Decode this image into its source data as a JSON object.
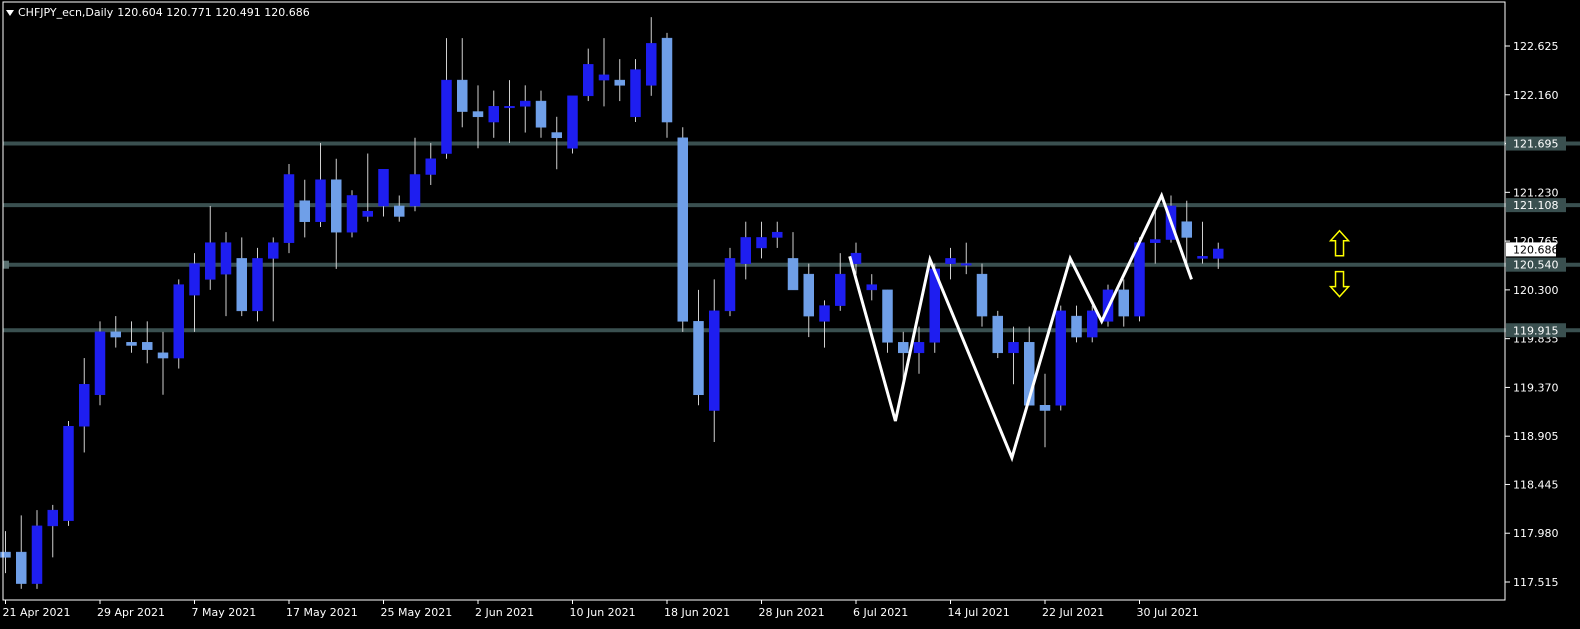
{
  "header": {
    "symbol_label": "CHFJPY_ecn,Daily",
    "ohlc": "120.604 120.771 120.491 120.686"
  },
  "colors": {
    "background": "#000000",
    "frame": "#ffffff",
    "bull_candle": "#1e1ef0",
    "bear_candle": "#6f9fe8",
    "wick": "#d0d0d0",
    "level_line": "#3a5050",
    "pattern_line": "#ffffff",
    "arrow": "#ffff00",
    "price_tag_bg": "#ffffff"
  },
  "icons": {
    "up_arrow": "up-arrow-icon",
    "down_arrow": "down-arrow-icon"
  },
  "chart_data": {
    "type": "candlestick",
    "title": "CHFJPY_ecn,Daily",
    "ylim": [
      117.3,
      122.9
    ],
    "grid": false,
    "y_ticks": [
      "122.625",
      "122.160",
      "121.695",
      "121.230",
      "120.765",
      "120.300",
      "119.835",
      "119.370",
      "118.905",
      "118.445",
      "117.980",
      "117.515"
    ],
    "x_ticks": [
      "21 Apr 2021",
      "29 Apr 2021",
      "7 May 2021",
      "17 May 2021",
      "25 May 2021",
      "2 Jun 2021",
      "10 Jun 2021",
      "18 Jun 2021",
      "28 Jun 2021",
      "6 Jul 2021",
      "14 Jul 2021",
      "22 Jul 2021",
      "30 Jul 2021"
    ],
    "current_price": "120.686",
    "levels": [
      {
        "price": 121.695,
        "label": "121.695"
      },
      {
        "price": 121.108,
        "label": "121.108"
      },
      {
        "price": 120.54,
        "label": "120.540"
      },
      {
        "price": 119.915,
        "label": "119.915"
      }
    ],
    "candles": [
      {
        "o": 117.8,
        "h": 118.0,
        "l": 117.6,
        "c": 117.75
      },
      {
        "o": 117.8,
        "h": 118.15,
        "l": 117.45,
        "c": 117.5
      },
      {
        "o": 117.5,
        "h": 118.2,
        "l": 117.45,
        "c": 118.05
      },
      {
        "o": 118.05,
        "h": 118.25,
        "l": 117.75,
        "c": 118.2
      },
      {
        "o": 118.1,
        "h": 119.05,
        "l": 118.05,
        "c": 119.0
      },
      {
        "o": 119.0,
        "h": 119.65,
        "l": 118.75,
        "c": 119.4
      },
      {
        "o": 119.3,
        "h": 120.0,
        "l": 119.2,
        "c": 119.9
      },
      {
        "o": 119.9,
        "h": 120.05,
        "l": 119.75,
        "c": 119.85
      },
      {
        "o": 119.8,
        "h": 120.0,
        "l": 119.7,
        "c": 119.77
      },
      {
        "o": 119.8,
        "h": 120.0,
        "l": 119.6,
        "c": 119.73
      },
      {
        "o": 119.7,
        "h": 119.9,
        "l": 119.3,
        "c": 119.65
      },
      {
        "o": 119.65,
        "h": 120.4,
        "l": 119.55,
        "c": 120.35
      },
      {
        "o": 120.25,
        "h": 120.65,
        "l": 119.9,
        "c": 120.55
      },
      {
        "o": 120.4,
        "h": 121.1,
        "l": 120.3,
        "c": 120.75
      },
      {
        "o": 120.45,
        "h": 120.85,
        "l": 120.05,
        "c": 120.75
      },
      {
        "o": 120.6,
        "h": 120.8,
        "l": 120.05,
        "c": 120.1
      },
      {
        "o": 120.1,
        "h": 120.7,
        "l": 120.0,
        "c": 120.6
      },
      {
        "o": 120.6,
        "h": 120.8,
        "l": 120.0,
        "c": 120.75
      },
      {
        "o": 120.75,
        "h": 121.5,
        "l": 120.65,
        "c": 121.4
      },
      {
        "o": 121.15,
        "h": 121.35,
        "l": 120.8,
        "c": 120.95
      },
      {
        "o": 120.95,
        "h": 121.7,
        "l": 120.9,
        "c": 121.35
      },
      {
        "o": 121.35,
        "h": 121.55,
        "l": 120.5,
        "c": 120.85
      },
      {
        "o": 120.85,
        "h": 121.25,
        "l": 120.8,
        "c": 121.2
      },
      {
        "o": 121.0,
        "h": 121.6,
        "l": 120.95,
        "c": 121.05
      },
      {
        "o": 121.1,
        "h": 121.4,
        "l": 121.0,
        "c": 121.45
      },
      {
        "o": 121.1,
        "h": 121.2,
        "l": 120.95,
        "c": 121.0
      },
      {
        "o": 121.1,
        "h": 121.75,
        "l": 121.05,
        "c": 121.4
      },
      {
        "o": 121.4,
        "h": 121.7,
        "l": 121.3,
        "c": 121.55
      },
      {
        "o": 121.6,
        "h": 122.7,
        "l": 121.55,
        "c": 122.3
      },
      {
        "o": 122.3,
        "h": 122.7,
        "l": 121.85,
        "c": 122.0
      },
      {
        "o": 122.0,
        "h": 122.25,
        "l": 121.65,
        "c": 121.95
      },
      {
        "o": 121.9,
        "h": 122.2,
        "l": 121.75,
        "c": 122.05
      },
      {
        "o": 122.05,
        "h": 122.3,
        "l": 121.7,
        "c": 122.05
      },
      {
        "o": 122.05,
        "h": 122.25,
        "l": 121.8,
        "c": 122.1
      },
      {
        "o": 122.1,
        "h": 122.2,
        "l": 121.75,
        "c": 121.85
      },
      {
        "o": 121.8,
        "h": 121.95,
        "l": 121.45,
        "c": 121.75
      },
      {
        "o": 121.65,
        "h": 122.1,
        "l": 121.6,
        "c": 122.15
      },
      {
        "o": 122.15,
        "h": 122.6,
        "l": 122.1,
        "c": 122.45
      },
      {
        "o": 122.3,
        "h": 122.7,
        "l": 122.05,
        "c": 122.35
      },
      {
        "o": 122.3,
        "h": 122.5,
        "l": 122.1,
        "c": 122.25
      },
      {
        "o": 121.95,
        "h": 122.5,
        "l": 121.9,
        "c": 122.4
      },
      {
        "o": 122.25,
        "h": 122.9,
        "l": 122.15,
        "c": 122.65
      },
      {
        "o": 122.7,
        "h": 122.75,
        "l": 121.75,
        "c": 121.9
      },
      {
        "o": 121.75,
        "h": 121.85,
        "l": 119.9,
        "c": 120.0
      },
      {
        "o": 120.0,
        "h": 120.3,
        "l": 119.2,
        "c": 119.3
      },
      {
        "o": 119.15,
        "h": 120.4,
        "l": 118.85,
        "c": 120.1
      },
      {
        "o": 120.1,
        "h": 120.7,
        "l": 120.05,
        "c": 120.6
      },
      {
        "o": 120.55,
        "h": 120.95,
        "l": 120.4,
        "c": 120.8
      },
      {
        "o": 120.7,
        "h": 120.95,
        "l": 120.6,
        "c": 120.8
      },
      {
        "o": 120.8,
        "h": 120.95,
        "l": 120.7,
        "c": 120.85
      },
      {
        "o": 120.6,
        "h": 120.85,
        "l": 120.3,
        "c": 120.3
      },
      {
        "o": 120.45,
        "h": 120.55,
        "l": 119.85,
        "c": 120.05
      },
      {
        "o": 120.0,
        "h": 120.2,
        "l": 119.75,
        "c": 120.15
      },
      {
        "o": 120.15,
        "h": 120.65,
        "l": 120.1,
        "c": 120.45
      },
      {
        "o": 120.55,
        "h": 120.75,
        "l": 120.45,
        "c": 120.65
      },
      {
        "o": 120.3,
        "h": 120.45,
        "l": 120.2,
        "c": 120.35
      },
      {
        "o": 120.3,
        "h": 120.3,
        "l": 119.7,
        "c": 119.8
      },
      {
        "o": 119.8,
        "h": 119.9,
        "l": 119.4,
        "c": 119.7
      },
      {
        "o": 119.7,
        "h": 119.95,
        "l": 119.5,
        "c": 119.8
      },
      {
        "o": 119.8,
        "h": 120.55,
        "l": 119.7,
        "c": 120.5
      },
      {
        "o": 120.55,
        "h": 120.7,
        "l": 120.4,
        "c": 120.6
      },
      {
        "o": 120.55,
        "h": 120.75,
        "l": 120.45,
        "c": 120.55
      },
      {
        "o": 120.45,
        "h": 120.55,
        "l": 119.95,
        "c": 120.05
      },
      {
        "o": 120.05,
        "h": 120.1,
        "l": 119.65,
        "c": 119.7
      },
      {
        "o": 119.7,
        "h": 119.95,
        "l": 119.4,
        "c": 119.8
      },
      {
        "o": 119.8,
        "h": 119.95,
        "l": 119.2,
        "c": 119.2
      },
      {
        "o": 119.2,
        "h": 119.5,
        "l": 118.8,
        "c": 119.15
      },
      {
        "o": 119.2,
        "h": 120.15,
        "l": 119.15,
        "c": 120.1
      },
      {
        "o": 120.05,
        "h": 120.15,
        "l": 119.8,
        "c": 119.85
      },
      {
        "o": 119.85,
        "h": 120.15,
        "l": 119.8,
        "c": 120.1
      },
      {
        "o": 120.0,
        "h": 120.35,
        "l": 119.95,
        "c": 120.3
      },
      {
        "o": 120.3,
        "h": 120.4,
        "l": 119.95,
        "c": 120.05
      },
      {
        "o": 120.05,
        "h": 120.8,
        "l": 120.0,
        "c": 120.75
      },
      {
        "o": 120.75,
        "h": 121.05,
        "l": 120.55,
        "c": 120.78
      },
      {
        "o": 120.78,
        "h": 121.2,
        "l": 120.75,
        "c": 121.1
      },
      {
        "o": 120.95,
        "h": 121.15,
        "l": 120.55,
        "c": 120.8
      },
      {
        "o": 120.6,
        "h": 120.95,
        "l": 120.55,
        "c": 120.62
      },
      {
        "o": 120.6,
        "h": 120.75,
        "l": 120.5,
        "c": 120.69
      }
    ],
    "pattern_line": [
      {
        "i": 53.6,
        "p": 120.62
      },
      {
        "i": 56.5,
        "p": 119.05
      },
      {
        "i": 58.7,
        "p": 120.59
      },
      {
        "i": 63.9,
        "p": 118.7
      },
      {
        "i": 67.6,
        "p": 120.6
      },
      {
        "i": 69.6,
        "p": 120.0
      },
      {
        "i": 73.4,
        "p": 121.2
      },
      {
        "i": 75.3,
        "p": 120.4
      }
    ],
    "arrows": [
      {
        "type": "up",
        "i": 84.7,
        "p": 120.74
      },
      {
        "type": "down",
        "i": 84.7,
        "p": 120.36
      }
    ]
  }
}
